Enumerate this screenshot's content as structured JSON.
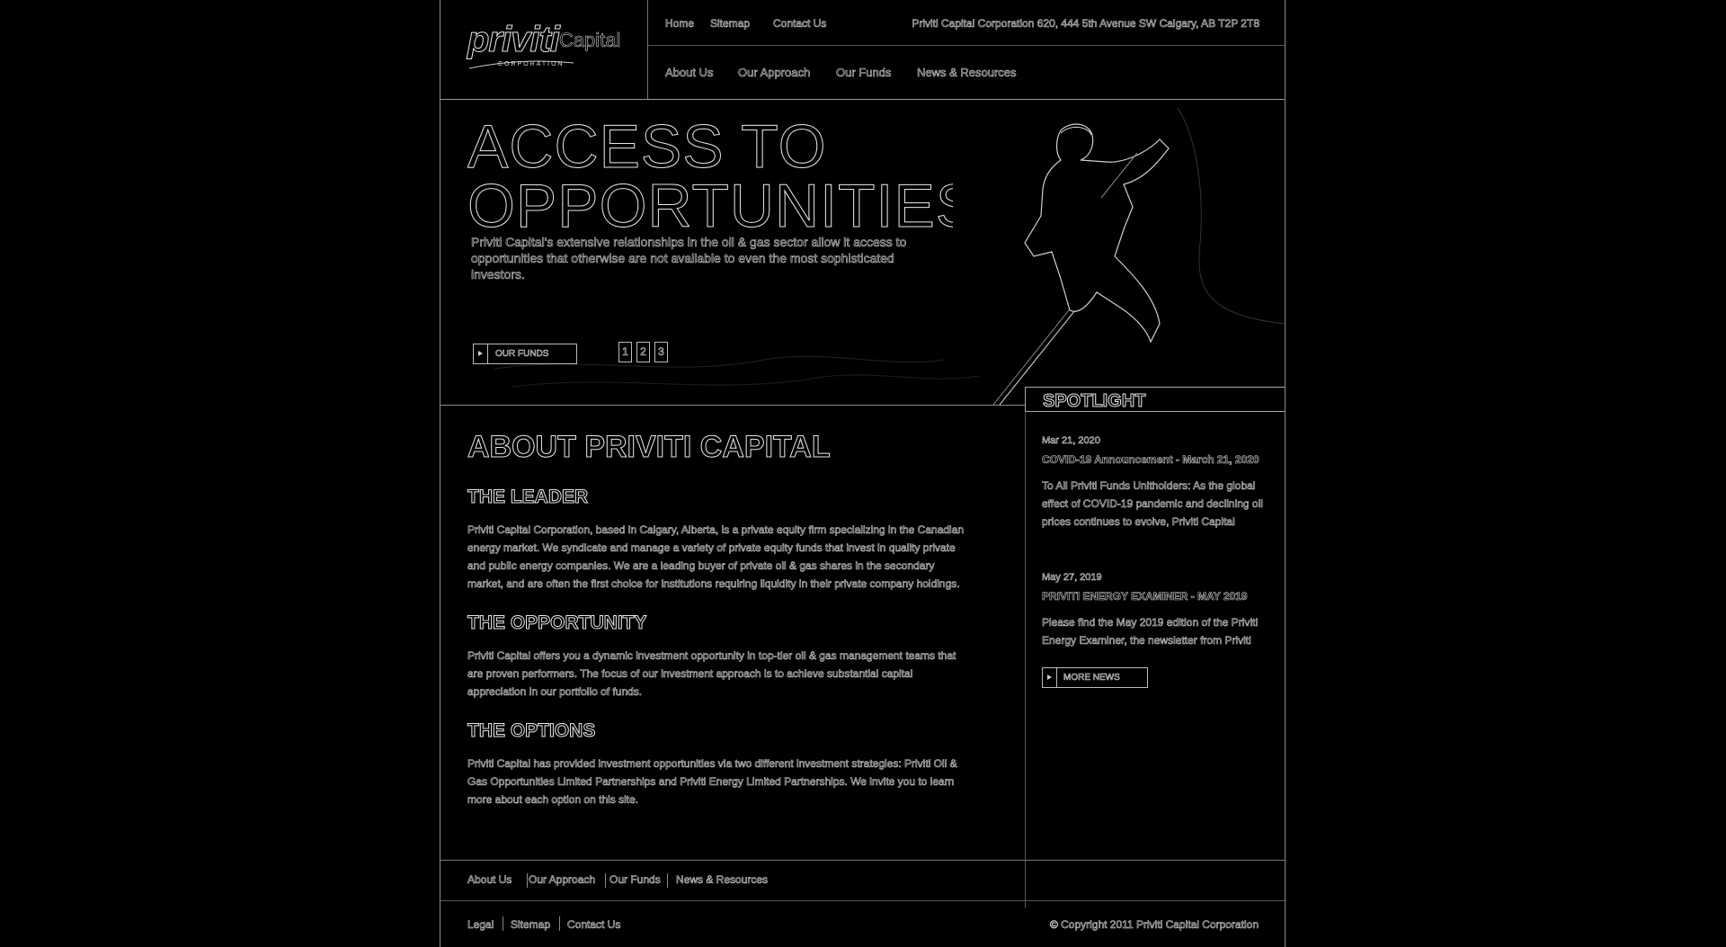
{
  "header": {
    "logo": {
      "brand": "priviti",
      "capital": "Capital",
      "corporation": "CORPORATION"
    },
    "top_links": [
      {
        "label": "Home"
      },
      {
        "label": "Sitemap"
      },
      {
        "label": "Contact Us"
      }
    ],
    "address": "Priviti Capital Corporation 620, 444 5th Avenue SW Calgary, AB T2P 2T8",
    "main_nav": [
      {
        "label": "About Us"
      },
      {
        "label": "Our Approach"
      },
      {
        "label": "Our Funds"
      },
      {
        "label": "News & Resources"
      }
    ]
  },
  "hero": {
    "title": "ACCESS TO OPPORTUNITIES",
    "text": "Priviti Capital's extensive relationships in the oil & gas sector allow it access to opportunities that otherwise are not available to even the most sophisticated investors.",
    "button_label": "OUR FUNDS",
    "pages": [
      "1",
      "2",
      "3"
    ]
  },
  "about": {
    "title": "ABOUT PRIVITI CAPITAL",
    "sections": [
      {
        "heading": "THE LEADER",
        "text": "Priviti Capital Corporation, based in Calgary, Alberta, is a private equity firm specializing in the Canadian energy market. We syndicate and manage a variety of private equity funds that invest in quality private and public energy companies. We are a leading buyer of private oil & gas shares in the secondary market, and are often the first choice for institutions requiring liquidity in their private company holdings."
      },
      {
        "heading": "THE OPPORTUNITY",
        "text": "Priviti Capital offers you a dynamic investment opportunity in top-tier oil & gas management teams that are proven performers. The focus of our investment approach is to achieve substantial capital appreciation in our portfolio of funds."
      },
      {
        "heading": "THE OPTIONS",
        "text": "Priviti Capital has provided investment opportunities via two different investment strategies: Priviti Oil & Gas Opportunities Limited Partnerships and Priviti Energy Limited Partnerships. We invite you to learn more about each option on this site."
      }
    ]
  },
  "spotlight": {
    "title": "SPOTLIGHT",
    "news": [
      {
        "date": "Mar 21, 2020",
        "title": "COVID-19 Announcement - March 21, 2020",
        "body": "To All Priviti Funds Unitholders: As the global effect of COVID-19 pandemic and declining oil prices continues to evolve, Priviti Capital Corporation is committed to"
      },
      {
        "date": "May 27, 2019",
        "title": "PRIVITI ENERGY EXAMINER - MAY 2019",
        "body": "Please find the May 2019 edition of the Priviti Energy Examiner, the newsletter from Priviti"
      }
    ],
    "more_label": "MORE NEWS"
  },
  "footer": {
    "nav": [
      {
        "label": "About Us"
      },
      {
        "label": "Our Approach"
      },
      {
        "label": "Our Funds"
      },
      {
        "label": "News & Resources"
      }
    ],
    "links": [
      {
        "label": "Legal"
      },
      {
        "label": "Sitemap"
      },
      {
        "label": "Contact Us"
      }
    ],
    "copyright": "© Copyright 2011 Priviti Capital Corporation"
  },
  "colors": {
    "background": "#000000",
    "outline": "#e6e6e6",
    "border": "#8a8a8a"
  }
}
